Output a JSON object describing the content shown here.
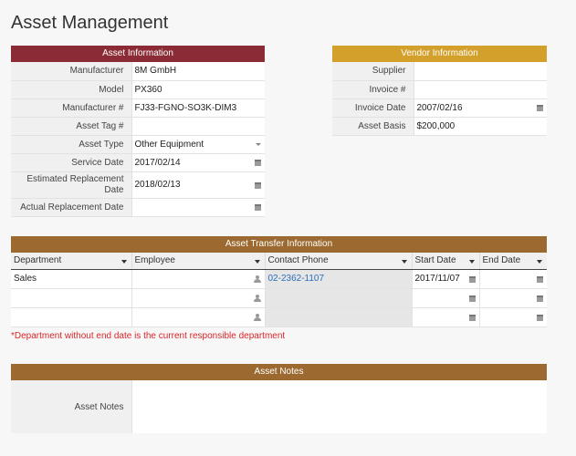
{
  "page": {
    "title": "Asset Management"
  },
  "asset_info": {
    "header": "Asset Information",
    "fields": [
      {
        "label": "Manufacturer",
        "value": "8M GmbH",
        "control": ""
      },
      {
        "label": "Model",
        "value": "PX360",
        "control": ""
      },
      {
        "label": "Manufacturer #",
        "value": "FJ33-FGNO-SO3K-DIM3",
        "control": ""
      },
      {
        "label": "Asset Tag #",
        "value": "",
        "control": ""
      },
      {
        "label": "Asset Type",
        "value": "Other Equipment",
        "control": "dropdown"
      },
      {
        "label": "Service Date",
        "value": "2017/02/14",
        "control": "calendar"
      },
      {
        "label": "Estimated Replacement Date",
        "value": "2018/02/13",
        "control": "calendar"
      },
      {
        "label": "Actual Replacement Date",
        "value": "",
        "control": "calendar"
      }
    ]
  },
  "vendor_info": {
    "header": "Vendor Information",
    "fields": [
      {
        "label": "Supplier",
        "value": "",
        "control": ""
      },
      {
        "label": "Invoice #",
        "value": "",
        "control": ""
      },
      {
        "label": "Invoice Date",
        "value": "2007/02/16",
        "control": "calendar"
      },
      {
        "label": "Asset Basis",
        "value": "$200,000",
        "control": ""
      }
    ]
  },
  "transfer": {
    "header": "Asset Transfer Information",
    "columns": [
      "Department",
      "Employee",
      "Contact Phone",
      "Start Date",
      "End Date"
    ],
    "rows": [
      {
        "department": "Sales",
        "employee": "",
        "phone": "02-2362-1107",
        "start": "2017/11/07",
        "end": ""
      },
      {
        "department": "",
        "employee": "",
        "phone": "",
        "start": "",
        "end": ""
      },
      {
        "department": "",
        "employee": "",
        "phone": "",
        "start": "",
        "end": ""
      }
    ],
    "note": "*Department without end date is the current responsible department"
  },
  "notes": {
    "header": "Asset Notes",
    "label": "Asset Notes",
    "value": ""
  },
  "colors": {
    "asset_header": "#8b2b35",
    "vendor_header": "#d4a02c",
    "transfer_header": "#9c6a30",
    "note_text": "#d9262a",
    "link": "#2a6fb5"
  }
}
